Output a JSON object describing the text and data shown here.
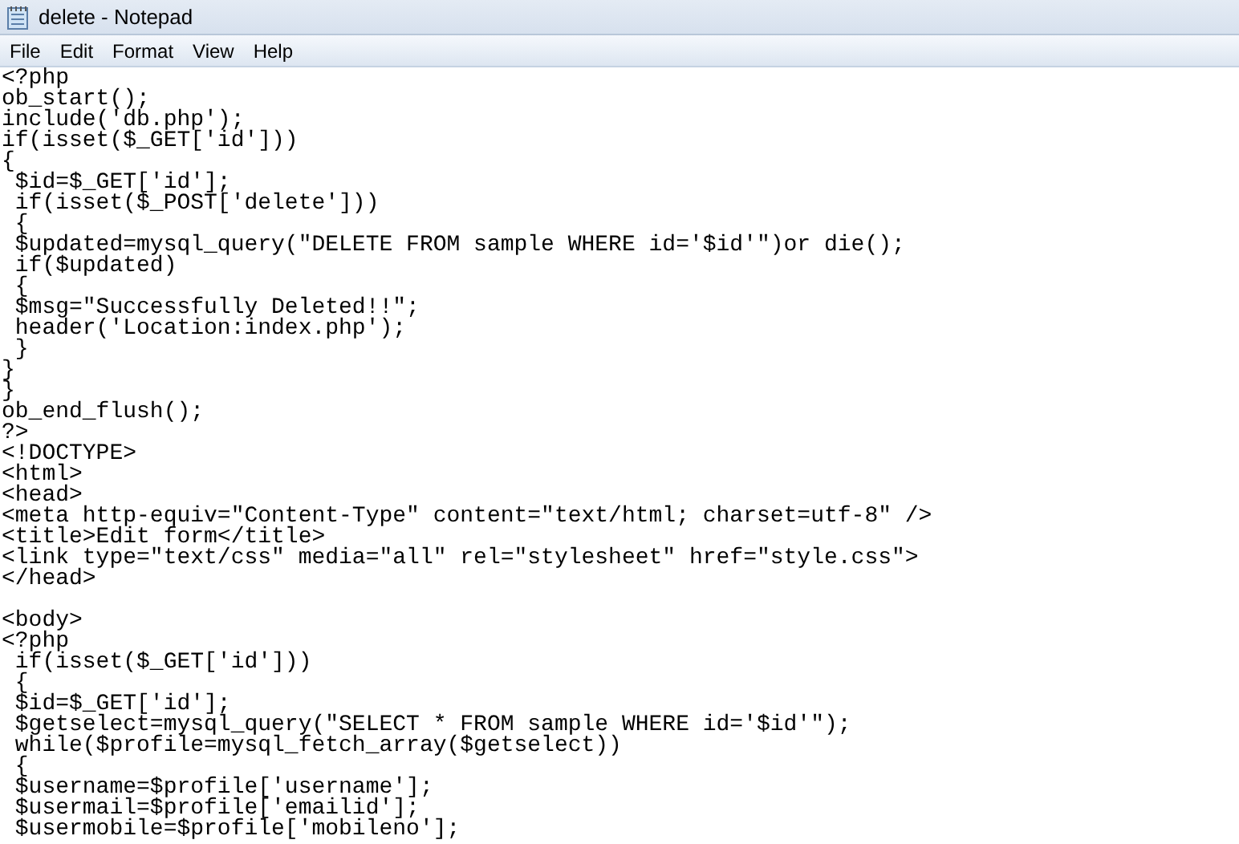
{
  "window": {
    "title": "delete - Notepad"
  },
  "menu": [
    "File",
    "Edit",
    "Format",
    "View",
    "Help"
  ],
  "lines": [
    {
      "kind": "text",
      "text": "<?php"
    },
    {
      "kind": "text",
      "text": "ob_start();"
    },
    {
      "kind": "text",
      "text": "include('db.php');"
    },
    {
      "kind": "text",
      "text": "if(isset($_GET['id']))"
    },
    {
      "kind": "text",
      "text": "{"
    },
    {
      "kind": "text",
      "text": " $id=$_GET['id'];"
    },
    {
      "kind": "text",
      "text": " if(isset($_POST['delete']))"
    },
    {
      "kind": "text",
      "text": " {"
    },
    {
      "kind": "text",
      "text": " $updated=mysql_query(\"DELETE FROM sample WHERE id='$id'\")or die();"
    },
    {
      "kind": "text",
      "text": " if($updated)"
    },
    {
      "kind": "text",
      "text": " {"
    },
    {
      "kind": "text",
      "text": " $msg=\"Successfully Deleted!!\";"
    },
    {
      "kind": "text",
      "text": " header('Location:index.php');"
    },
    {
      "kind": "text",
      "text": " }"
    },
    {
      "kind": "text",
      "text": "}"
    },
    {
      "kind": "text",
      "text": "}"
    },
    {
      "kind": "text",
      "text": "ob_end_flush();"
    },
    {
      "kind": "text",
      "text": "?>"
    },
    {
      "kind": "text",
      "text": "<!DOCTYPE>"
    },
    {
      "kind": "text",
      "text": "<html>"
    },
    {
      "kind": "text",
      "text": "<head>"
    },
    {
      "kind": "text",
      "text": "<meta http-equiv=\"Content-Type\" content=\"text/html; charset=utf-8\" />"
    },
    {
      "kind": "text",
      "text": "<title>Edit form</title>"
    },
    {
      "kind": "text",
      "text": "<link type=\"text/css\" media=\"all\" rel=\"stylesheet\" href=\"style.css\">"
    },
    {
      "kind": "text",
      "text": "</head>"
    },
    {
      "kind": "blank"
    },
    {
      "kind": "text",
      "text": "<body>"
    },
    {
      "kind": "text",
      "text": "<?php"
    },
    {
      "kind": "text",
      "text": " if(isset($_GET['id']))"
    },
    {
      "kind": "text",
      "text": " {"
    },
    {
      "kind": "text",
      "text": " $id=$_GET['id'];"
    },
    {
      "kind": "text",
      "text": " $getselect=mysql_query(\"SELECT * FROM sample WHERE id='$id'\");"
    },
    {
      "kind": "text",
      "text": " while($profile=mysql_fetch_array($getselect))"
    },
    {
      "kind": "text",
      "text": " {"
    },
    {
      "kind": "text",
      "text": " $username=$profile['username'];"
    },
    {
      "kind": "text",
      "text": " $usermail=$profile['emailid'];"
    },
    {
      "kind": "text",
      "text": " $usermobile=$profile['mobileno'];"
    }
  ]
}
